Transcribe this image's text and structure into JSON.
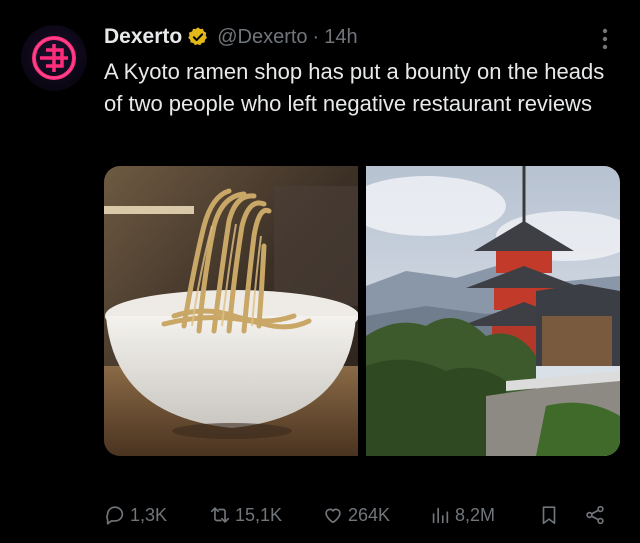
{
  "post": {
    "author_name": "Dexerto",
    "handle": "@Dexerto",
    "separator": "·",
    "time": "14h",
    "text": "A Kyoto ramen shop has put a bounty on the heads of two people who left negative restaurant reviews"
  },
  "icons": {
    "avatar": "dexerto-logo",
    "badge": "gold-verified-badge",
    "more": "more-vertical-icon",
    "reply": "reply-icon",
    "repost": "repost-icon",
    "like": "like-icon",
    "views": "views-icon",
    "bookmark": "bookmark-icon",
    "share": "share-icon"
  },
  "metrics": {
    "replies": "1,3K",
    "reposts": "15,1K",
    "likes": "264K",
    "views": "8,2M"
  },
  "colors": {
    "background": "#000000",
    "text_primary": "#e7e9ea",
    "text_secondary": "#71767b",
    "badge_gold": "#e2b719",
    "brand_pink": "#ff2d7a"
  }
}
